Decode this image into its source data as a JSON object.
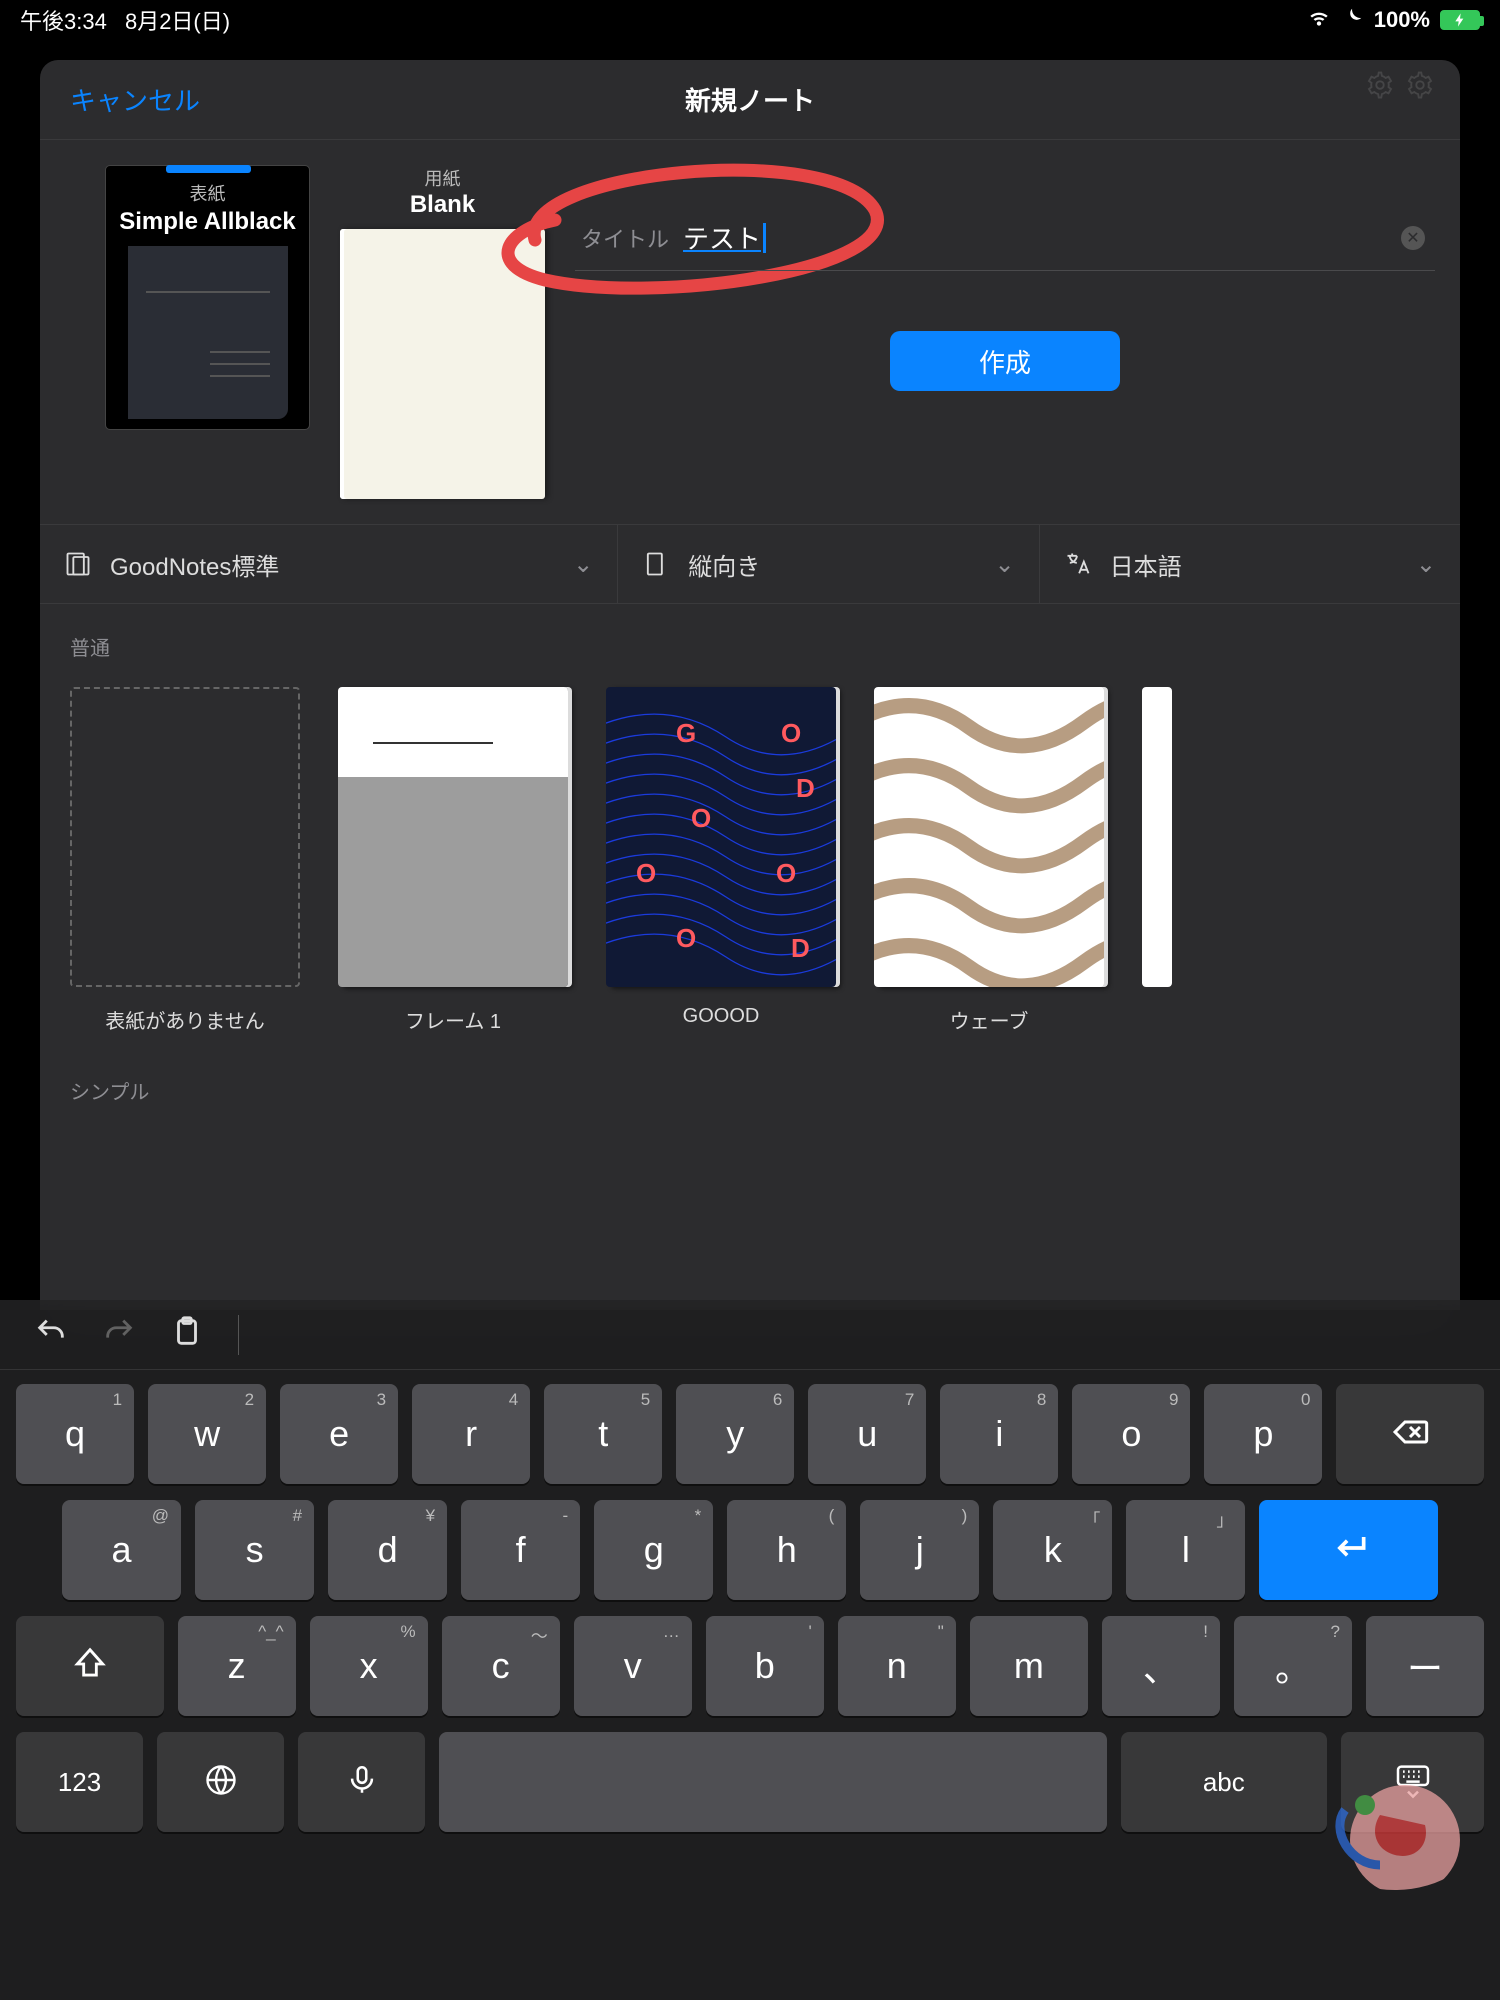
{
  "status": {
    "time": "午後3:34",
    "date": "8月2日(日)",
    "battery": "100%"
  },
  "sheet": {
    "cancel": "キャンセル",
    "title": "新規ノート",
    "cover": {
      "label": "表紙",
      "name": "Simple Allblack"
    },
    "paper": {
      "label": "用紙",
      "name": "Blank"
    },
    "titleField": {
      "placeholder": "タイトル",
      "value": "テスト"
    },
    "create": "作成"
  },
  "selectors": {
    "size": "GoodNotes標準",
    "orientation": "縦向き",
    "language": "日本語"
  },
  "sections": {
    "normal": "普通",
    "simple": "シンプル"
  },
  "templates": [
    {
      "caption": "表紙がありません"
    },
    {
      "caption": "フレーム 1"
    },
    {
      "caption": "GOOOD"
    },
    {
      "caption": "ウェーブ"
    }
  ],
  "keyboard": {
    "row1": [
      {
        "m": "q",
        "s": "1"
      },
      {
        "m": "w",
        "s": "2"
      },
      {
        "m": "e",
        "s": "3"
      },
      {
        "m": "r",
        "s": "4"
      },
      {
        "m": "t",
        "s": "5"
      },
      {
        "m": "y",
        "s": "6"
      },
      {
        "m": "u",
        "s": "7"
      },
      {
        "m": "i",
        "s": "8"
      },
      {
        "m": "o",
        "s": "9"
      },
      {
        "m": "p",
        "s": "0"
      }
    ],
    "row2": [
      {
        "m": "a",
        "s": "@"
      },
      {
        "m": "s",
        "s": "#"
      },
      {
        "m": "d",
        "s": "¥"
      },
      {
        "m": "f",
        "s": "-"
      },
      {
        "m": "g",
        "s": "*"
      },
      {
        "m": "h",
        "s": "("
      },
      {
        "m": "j",
        "s": ")"
      },
      {
        "m": "k",
        "s": "「"
      },
      {
        "m": "l",
        "s": "」"
      }
    ],
    "row3": [
      {
        "m": "z",
        "s": "^_^"
      },
      {
        "m": "x",
        "s": "%"
      },
      {
        "m": "c",
        "s": "〜"
      },
      {
        "m": "v",
        "s": "…"
      },
      {
        "m": "b",
        "s": "'"
      },
      {
        "m": "n",
        "s": "\""
      },
      {
        "m": "m",
        "s": ""
      },
      {
        "m": "、",
        "s": "!"
      },
      {
        "m": "。",
        "s": "?"
      },
      {
        "m": "ー",
        "s": ""
      }
    ],
    "numLabel": "123",
    "abcLabel": "abc"
  }
}
